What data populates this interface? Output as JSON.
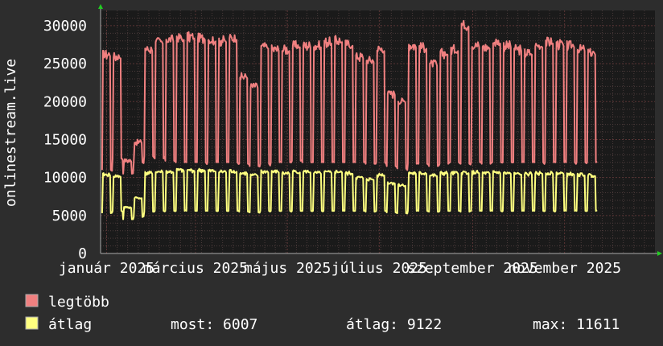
{
  "chart_data": {
    "type": "line",
    "ylabel": "onlinestream.live",
    "ylim": [
      0,
      32000
    ],
    "y_ticks": [
      0,
      5000,
      10000,
      15000,
      20000,
      25000,
      30000
    ],
    "x_ticks": [
      "január 2025",
      "március 2025",
      "május 2025",
      "július 2025",
      "szeptember 2025",
      "november 2025"
    ],
    "x_start": "2024-12-28",
    "x_end": "2025-12-31",
    "x_tick_dates": [
      "2025-01-01",
      "2025-03-01",
      "2025-05-01",
      "2025-07-01",
      "2025-09-01",
      "2025-11-01"
    ],
    "grid": true,
    "colors": {
      "legtobb": "#f08080",
      "atlag": "#ffff80",
      "background": "#1a1a1a",
      "grid": "#5a3535"
    },
    "series": [
      {
        "name": "legtöbb",
        "color": "#f08080"
      },
      {
        "name": "átlag",
        "color": "#ffff80"
      }
    ],
    "weekly_peaks": {
      "legtobb": [
        26800,
        26500,
        12500,
        15000,
        27500,
        28500,
        28800,
        29000,
        29200,
        29000,
        28800,
        28700,
        29000,
        23800,
        22500,
        27800,
        27500,
        27500,
        28000,
        28000,
        28000,
        28500,
        28700,
        28200,
        26500,
        26000,
        27500,
        21500,
        20500,
        28000,
        27800,
        25500,
        27000,
        27500,
        30800,
        28000,
        27800,
        28500,
        28000,
        27500,
        27000,
        28000,
        28500,
        28200,
        28000,
        27500,
        27000
      ],
      "atlag": [
        10600,
        10400,
        6200,
        7500,
        10800,
        11000,
        11000,
        11200,
        11200,
        11200,
        11100,
        11000,
        11100,
        10800,
        10500,
        11000,
        11000,
        10800,
        11000,
        11000,
        10800,
        10900,
        11000,
        10800,
        10200,
        10000,
        10600,
        9500,
        9200,
        10800,
        10800,
        10500,
        10800,
        10800,
        10900,
        10900,
        10800,
        10900,
        10800,
        10700,
        10700,
        10800,
        10800,
        10800,
        10700,
        10600,
        10500
      ]
    },
    "weekly_troughs": {
      "legtobb": [
        11000,
        12500,
        10500,
        12000,
        12800,
        12500,
        12200,
        12000,
        12000,
        12000,
        12000,
        12000,
        12000,
        11800,
        11500,
        11800,
        12000,
        12000,
        12200,
        12000,
        12000,
        12000,
        12000,
        12000,
        12000,
        11800,
        12000,
        11500,
        11200,
        11800,
        11800,
        11500,
        11800,
        12000,
        11800,
        12000,
        11800,
        12000,
        12000,
        12000,
        12000,
        12000,
        12000,
        12000,
        12000,
        12000,
        12000
      ],
      "atlag": [
        5300,
        5600,
        4500,
        4800,
        5500,
        5600,
        5600,
        5600,
        5600,
        5600,
        5600,
        5600,
        5600,
        5500,
        5400,
        5600,
        5600,
        5600,
        5600,
        5600,
        5600,
        5600,
        5600,
        5600,
        5600,
        5500,
        5600,
        5400,
        5300,
        5600,
        5600,
        5500,
        5600,
        5600,
        5500,
        5600,
        5600,
        5600,
        5600,
        5600,
        5600,
        5600,
        5600,
        5600,
        5600,
        5600,
        5600
      ]
    }
  },
  "legend": {
    "items": [
      {
        "label": "legtöbb",
        "color": "#f08080"
      },
      {
        "label": "átlag",
        "color": "#ffff80"
      }
    ],
    "stats": {
      "most": "most: 6007",
      "atlag": "átlag: 9122",
      "max": "max: 11611"
    }
  }
}
